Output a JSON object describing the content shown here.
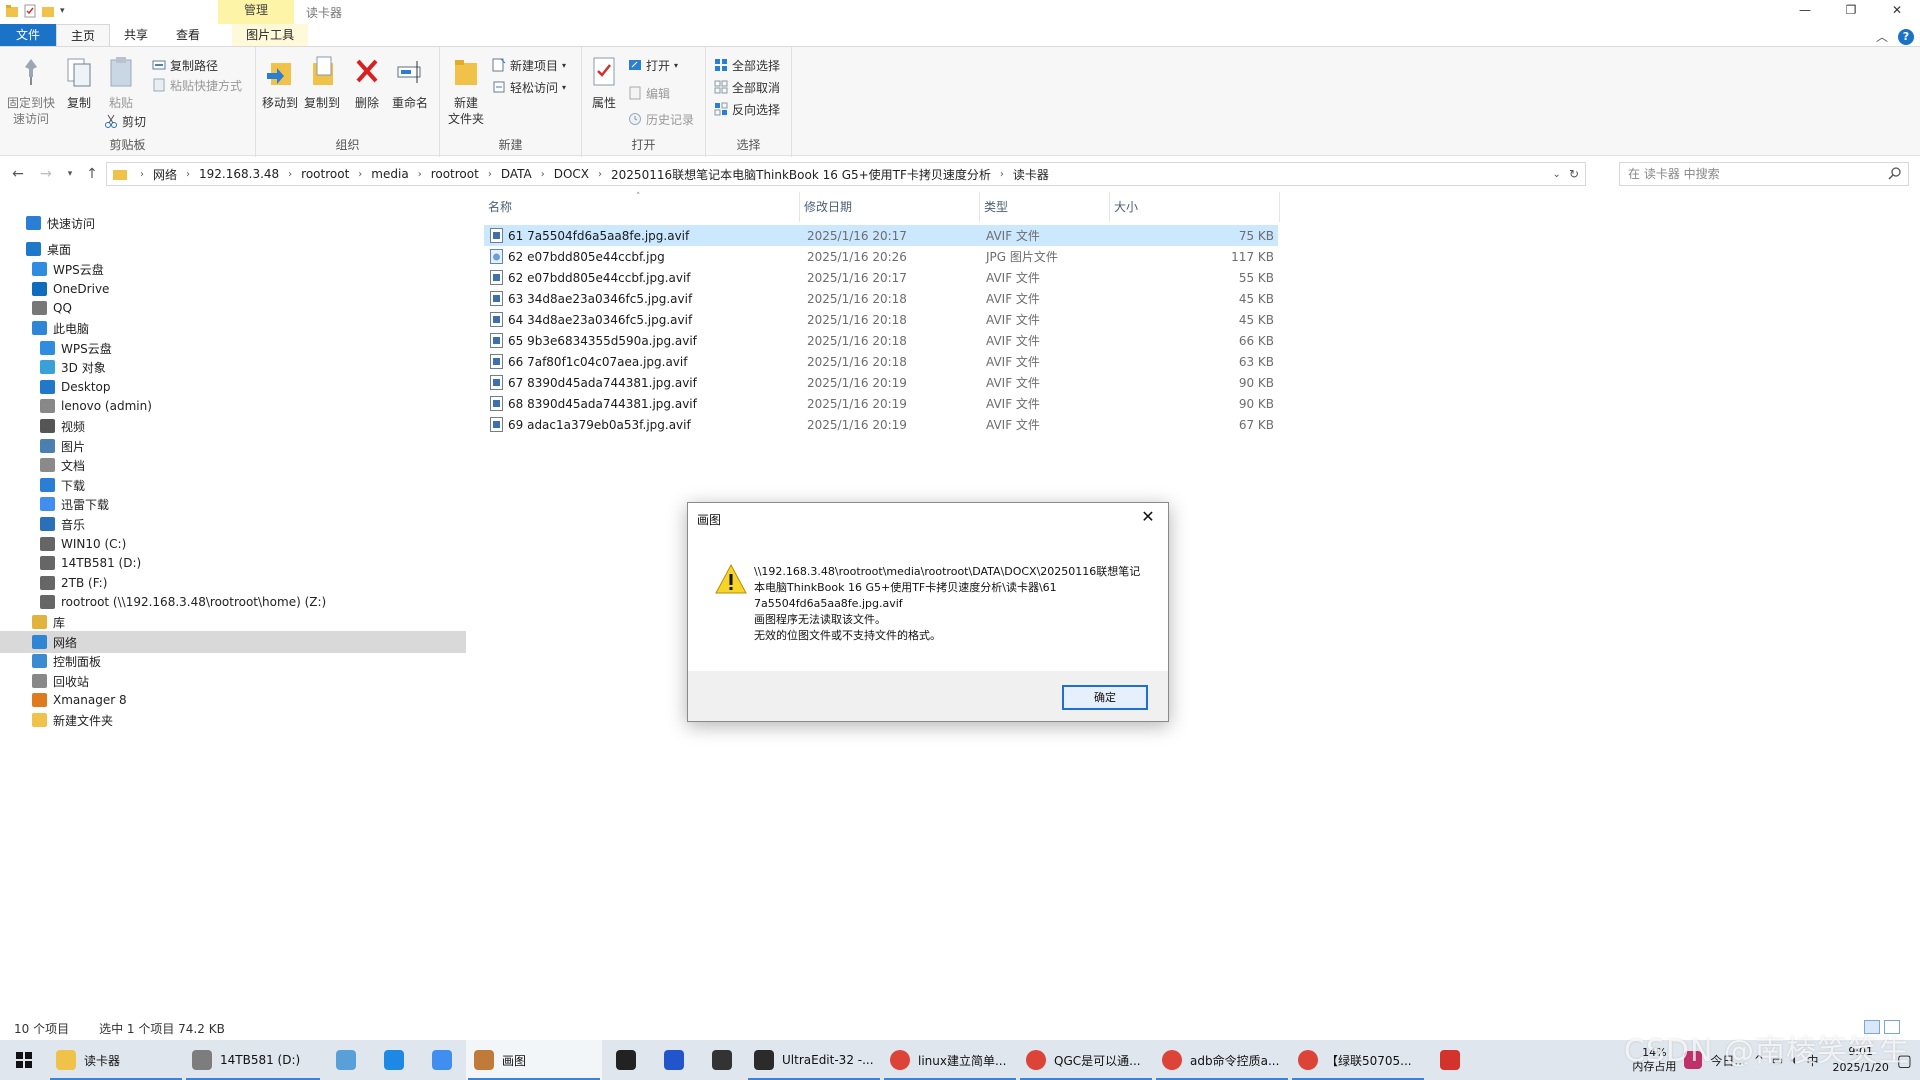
{
  "window": {
    "title": "读卡器",
    "context_tab": "管理",
    "buttons": [
      "—",
      "❐",
      "✕"
    ]
  },
  "tabs": [
    "文件",
    "主页",
    "共享",
    "查看",
    "图片工具"
  ],
  "ribbon": {
    "clipboard": {
      "label": "剪贴板",
      "pin": "固定到快\n速访问",
      "copy": "复制",
      "paste": "粘贴",
      "copy_path": "复制路径",
      "paste_shortcut": "粘贴快捷方式",
      "cut": "剪切"
    },
    "organize": {
      "label": "组织",
      "move_to": "移动到",
      "copy_to": "复制到",
      "delete": "删除",
      "rename": "重命名"
    },
    "new": {
      "label": "新建",
      "new_folder": "新建\n文件夹",
      "new_item": "新建项目",
      "easy_access": "轻松访问"
    },
    "open": {
      "label": "打开",
      "properties": "属性",
      "open": "打开",
      "edit": "编辑",
      "history": "历史记录"
    },
    "select": {
      "label": "选择",
      "select_all": "全部选择",
      "select_none": "全部取消",
      "invert": "反向选择"
    }
  },
  "address": {
    "crumbs": [
      "网络",
      "192.168.3.48",
      "rootroot",
      "media",
      "rootroot",
      "DATA",
      "DOCX",
      "20250116联想笔记本电脑ThinkBook 16 G5+使用TF卡拷贝速度分析",
      "读卡器"
    ],
    "search_placeholder": "在 读卡器 中搜索"
  },
  "navpane": [
    {
      "label": "快速访问",
      "icon": "star-icon",
      "color": "#2a7fd4",
      "indent": 1
    },
    {
      "label": "桌面",
      "icon": "desktop-icon",
      "color": "#1f78c8",
      "indent": 1
    },
    {
      "label": "WPS云盘",
      "icon": "cloud-icon",
      "color": "#2e8de0",
      "indent": 2
    },
    {
      "label": "OneDrive",
      "icon": "onedrive-icon",
      "color": "#0f6cbd",
      "indent": 2
    },
    {
      "label": "QQ",
      "icon": "user-icon",
      "color": "#777777",
      "indent": 2
    },
    {
      "label": "此电脑",
      "icon": "computer-icon",
      "color": "#2f86d6",
      "indent": 2
    },
    {
      "label": "WPS云盘",
      "icon": "cloud-icon",
      "color": "#2e8de0",
      "indent": 3
    },
    {
      "label": "3D 对象",
      "icon": "cube-icon",
      "color": "#3aa0d8",
      "indent": 3
    },
    {
      "label": "Desktop",
      "icon": "desktop-icon",
      "color": "#1f78c8",
      "indent": 3
    },
    {
      "label": "lenovo (admin)",
      "icon": "user-folder-icon",
      "color": "#888888",
      "indent": 3
    },
    {
      "label": "视频",
      "icon": "video-icon",
      "color": "#555555",
      "indent": 3
    },
    {
      "label": "图片",
      "icon": "picture-icon",
      "color": "#4a7fb0",
      "indent": 3
    },
    {
      "label": "文档",
      "icon": "document-icon",
      "color": "#8a8a8a",
      "indent": 3
    },
    {
      "label": "下载",
      "icon": "download-icon",
      "color": "#2a7fd4",
      "indent": 3
    },
    {
      "label": "迅雷下载",
      "icon": "thunder-icon",
      "color": "#3f8ef0",
      "indent": 3
    },
    {
      "label": "音乐",
      "icon": "music-icon",
      "color": "#2a6fb8",
      "indent": 3
    },
    {
      "label": "WIN10 (C:)",
      "icon": "drive-icon",
      "color": "#666666",
      "indent": 3
    },
    {
      "label": "14TB581 (D:)",
      "icon": "drive-icon",
      "color": "#666666",
      "indent": 3
    },
    {
      "label": "2TB (F:)",
      "icon": "drive-icon",
      "color": "#666666",
      "indent": 3
    },
    {
      "label": "rootroot (\\\\192.168.3.48\\rootroot\\home) (Z:)",
      "icon": "network-drive-icon",
      "color": "#666666",
      "indent": 3
    },
    {
      "label": "库",
      "icon": "library-icon",
      "color": "#e2b33c",
      "indent": 2
    },
    {
      "label": "网络",
      "icon": "network-icon",
      "color": "#2f86d6",
      "indent": 2,
      "selected": true
    },
    {
      "label": "控制面板",
      "icon": "control-panel-icon",
      "color": "#3a8bd0",
      "indent": 2
    },
    {
      "label": "回收站",
      "icon": "recycle-bin-icon",
      "color": "#888888",
      "indent": 2
    },
    {
      "label": "Xmanager 8",
      "icon": "xmanager-icon",
      "color": "#e07a1f",
      "indent": 2
    },
    {
      "label": "新建文件夹",
      "icon": "folder-icon",
      "color": "#f0c24a",
      "indent": 2
    }
  ],
  "columns": [
    "名称",
    "修改日期",
    "类型",
    "大小"
  ],
  "files": [
    {
      "name": "61 7a5504fd6a5aa8fe.jpg.avif",
      "date": "2025/1/16 20:17",
      "type": "AVIF 文件",
      "size": "75 KB",
      "selected": true,
      "kind": "avif"
    },
    {
      "name": "62 e07bdd805e44ccbf.jpg",
      "date": "2025/1/16 20:26",
      "type": "JPG 图片文件",
      "size": "117 KB",
      "kind": "jpg"
    },
    {
      "name": "62 e07bdd805e44ccbf.jpg.avif",
      "date": "2025/1/16 20:17",
      "type": "AVIF 文件",
      "size": "55 KB",
      "kind": "avif"
    },
    {
      "name": "63 34d8ae23a0346fc5.jpg.avif",
      "date": "2025/1/16 20:18",
      "type": "AVIF 文件",
      "size": "45 KB",
      "kind": "avif"
    },
    {
      "name": "64 34d8ae23a0346fc5.jpg.avif",
      "date": "2025/1/16 20:18",
      "type": "AVIF 文件",
      "size": "45 KB",
      "kind": "avif"
    },
    {
      "name": "65 9b3e6834355d590a.jpg.avif",
      "date": "2025/1/16 20:18",
      "type": "AVIF 文件",
      "size": "66 KB",
      "kind": "avif"
    },
    {
      "name": "66 7af80f1c04c07aea.jpg.avif",
      "date": "2025/1/16 20:18",
      "type": "AVIF 文件",
      "size": "63 KB",
      "kind": "avif"
    },
    {
      "name": "67 8390d45ada744381.jpg.avif",
      "date": "2025/1/16 20:19",
      "type": "AVIF 文件",
      "size": "90 KB",
      "kind": "avif"
    },
    {
      "name": "68 8390d45ada744381.jpg.avif",
      "date": "2025/1/16 20:19",
      "type": "AVIF 文件",
      "size": "90 KB",
      "kind": "avif"
    },
    {
      "name": "69 adac1a379eb0a53f.jpg.avif",
      "date": "2025/1/16 20:19",
      "type": "AVIF 文件",
      "size": "67 KB",
      "kind": "avif"
    }
  ],
  "dialog": {
    "title": "画图",
    "message_lines": [
      "\\\\192.168.3.48\\rootroot\\media\\rootroot\\DATA\\DOCX\\20250116联想笔记",
      "本电脑ThinkBook 16 G5+使用TF卡拷贝速度分析\\读卡器\\61",
      "7a5504fd6a5aa8fe.jpg.avif",
      "画图程序无法读取该文件。",
      "无效的位图文件或不支持文件的格式。"
    ],
    "ok": "确定"
  },
  "status": {
    "count": "10 个项目",
    "selected": "选中 1 个项目  74.2 KB"
  },
  "taskbar": {
    "items": [
      {
        "label": "读卡器",
        "icon": "folder-icon",
        "color": "#f0c24a",
        "open": true
      },
      {
        "label": "14TB581 (D:)",
        "icon": "drive-icon",
        "color": "#7d7d7d",
        "open": true
      },
      {
        "label": "",
        "icon": "notepad-icon",
        "color": "#5aa0d8",
        "open": false
      },
      {
        "label": "",
        "icon": "browser-icon",
        "color": "#1e88e5",
        "open": false
      },
      {
        "label": "",
        "icon": "thunder-icon",
        "color": "#3f8ef0",
        "open": false
      },
      {
        "label": "画图",
        "icon": "paint-icon",
        "color": "#c07a3a",
        "open": true,
        "active": true
      },
      {
        "label": "",
        "icon": "terminal-icon",
        "color": "#222222",
        "open": false
      },
      {
        "label": "",
        "icon": "app-icon",
        "color": "#2255cc",
        "open": false
      },
      {
        "label": "",
        "icon": "obs-icon",
        "color": "#333333",
        "open": false
      },
      {
        "label": "UltraEdit-32 -...",
        "icon": "ultraedit-icon",
        "color": "#2b2b2b",
        "open": true
      },
      {
        "label": "linux建立简单...",
        "icon": "chrome-icon",
        "color": "#db4437",
        "open": true
      },
      {
        "label": "QGC是可以通...",
        "icon": "chrome-icon",
        "color": "#db4437",
        "open": true
      },
      {
        "label": "adb命令控质a...",
        "icon": "chrome-icon",
        "color": "#db4437",
        "open": true
      },
      {
        "label": "【绿联50705...",
        "icon": "chrome-icon",
        "color": "#db4437",
        "open": true
      },
      {
        "label": "",
        "icon": "wps-icon",
        "color": "#d3332b",
        "open": false
      }
    ],
    "memory_pct": "14%",
    "memory_label": "内存占用",
    "tray_extra": "今日...",
    "time": "9:01",
    "date": "2025/1/20",
    "watermark": "CSDN @南棱笑笑生"
  }
}
